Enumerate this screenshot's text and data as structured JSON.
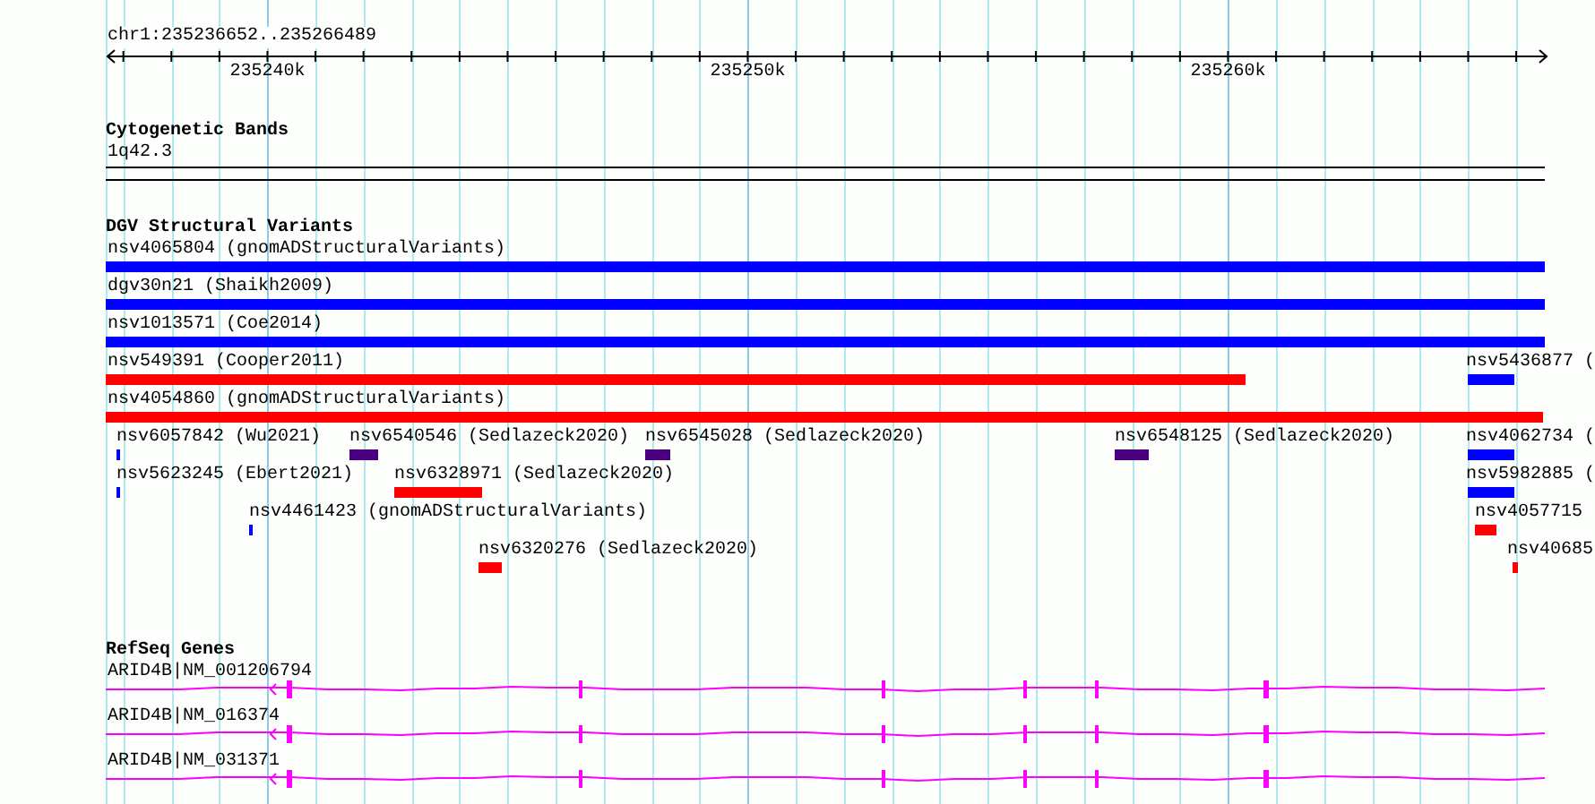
{
  "ruler": {
    "location": "chr1:235236652..235266489",
    "ticks": [
      "235240k",
      "235250k",
      "235260k"
    ]
  },
  "tracks": [
    {
      "kind": "bands",
      "title": "Cytogenetic Bands",
      "features": [
        {
          "label": "1q42.3"
        }
      ]
    },
    {
      "kind": "variants",
      "title": "DGV Structural Variants",
      "features": [
        {
          "label": "nsv4065804 (gnomADStructuralVariants)",
          "color": "#0000ff"
        },
        {
          "label": "dgv30n21 (Shaikh2009)",
          "color": "#0000ff"
        },
        {
          "label": "nsv1013571 (Coe2014)",
          "color": "#0000ff"
        },
        {
          "label": "nsv549391 (Cooper2011)",
          "color": "#ff0000"
        },
        {
          "label": "nsv5436877 (",
          "color": "#0000ff"
        },
        {
          "label": "nsv4054860 (gnomADStructuralVariants)",
          "color": "#ff0000"
        },
        {
          "label": "nsv6057842 (Wu2021)",
          "color": "#0000ff"
        },
        {
          "label": "nsv6540546 (Sedlazeck2020)",
          "color": "#4b0082"
        },
        {
          "label": "nsv6545028 (Sedlazeck2020)",
          "color": "#4b0082"
        },
        {
          "label": "nsv6548125 (Sedlazeck2020)",
          "color": "#4b0082"
        },
        {
          "label": "nsv4062734 (",
          "color": "#0000ff"
        },
        {
          "label": "nsv5623245 (Ebert2021)",
          "color": "#0000ff"
        },
        {
          "label": "nsv6328971 (Sedlazeck2020)",
          "color": "#ff0000"
        },
        {
          "label": "nsv5982885 (",
          "color": "#0000ff"
        },
        {
          "label": "nsv4461423 (gnomADStructuralVariants)",
          "color": "#0000ff"
        },
        {
          "label": "nsv4057715",
          "color": "#ff0000"
        },
        {
          "label": "nsv6320276 (Sedlazeck2020)",
          "color": "#ff0000"
        },
        {
          "label": "nsv40685",
          "color": "#ff0000"
        }
      ]
    },
    {
      "kind": "genes",
      "title": "RefSeq Genes",
      "features": [
        {
          "label": "ARID4B|NM_001206794"
        },
        {
          "label": "ARID4B|NM_016374"
        },
        {
          "label": "ARID4B|NM_031371"
        }
      ]
    }
  ]
}
